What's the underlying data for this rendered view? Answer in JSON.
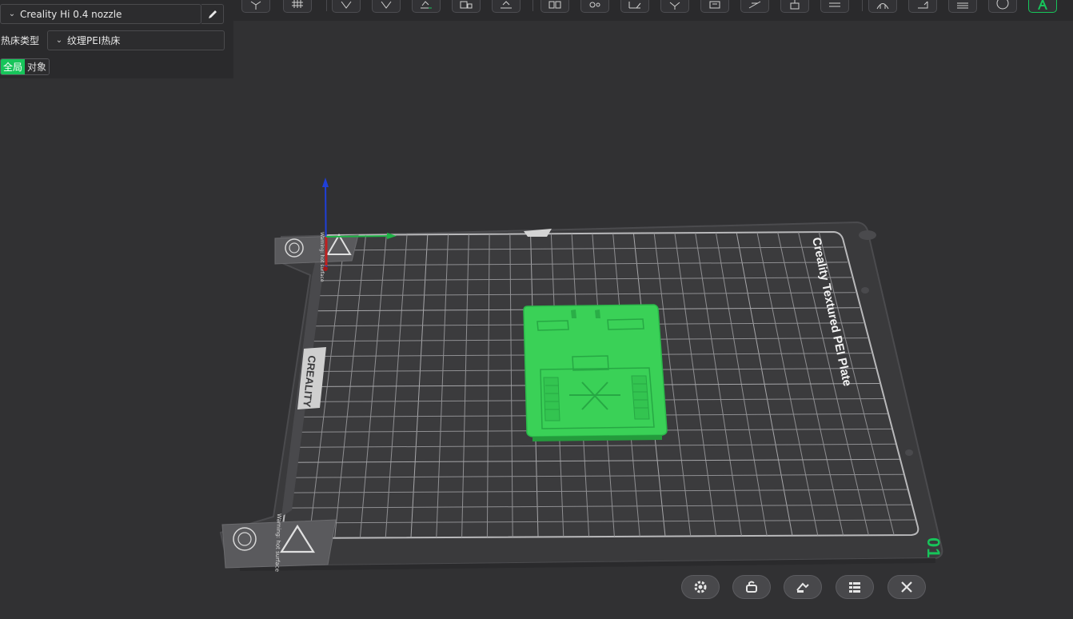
{
  "left_panel": {
    "printer_preset": "Creality Hi 0.4 nozzle",
    "bed_type_label": "热床类型",
    "bed_type_value": "纹理PEI热床",
    "scope_tabs": [
      {
        "label": "全局",
        "active": true
      },
      {
        "label": "对象",
        "active": false
      }
    ]
  },
  "plate": {
    "side_text": "Creality Textured PEI Plate",
    "brand_logo_text": "CREALITY",
    "warning_text": "Warning: hot surface",
    "plate_number": "01"
  },
  "colors": {
    "accent": "#17c45a",
    "model": "#3ad157",
    "plate": "#3a3a3c",
    "background": "#313133"
  },
  "toolbar_icons": [
    "cube-view-icon",
    "grid-layout-icon",
    "add-object-icon",
    "remove-object-icon",
    "auto-orient-icon",
    "arrange-icon",
    "lay-on-face-icon",
    "split-objects-icon",
    "settings-gear-icon",
    "measure-icon",
    "cut-icon",
    "support-paint-icon",
    "seam-paint-icon",
    "scale-icon",
    "rotate-icon",
    "text-emboss-icon",
    "assembly-icon",
    "variable-layer-icon",
    "color-paint-icon",
    "mesh-boolean-icon",
    "a-text-icon"
  ],
  "plate_buttons": [
    "plate-settings-gear-icon",
    "lock-plate-icon",
    "auto-arrange-icon",
    "plate-list-icon",
    "close-plate-icon"
  ]
}
